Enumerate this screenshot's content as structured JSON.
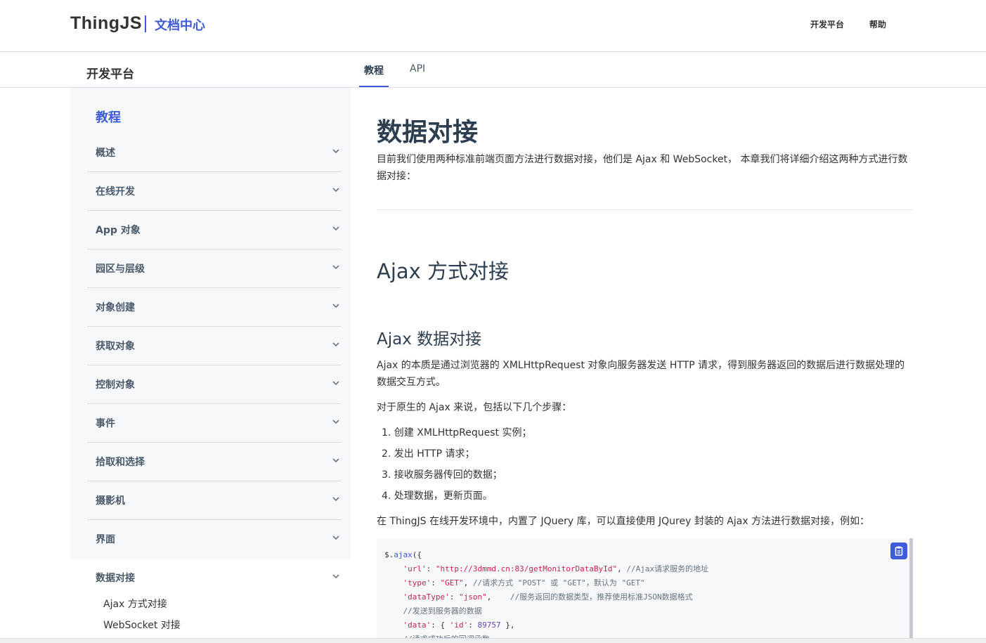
{
  "header": {
    "logo_text": "ThingJS",
    "logo_sub": "文档中心",
    "nav": [
      {
        "label": "开发平台"
      },
      {
        "label": "帮助"
      }
    ]
  },
  "subbar": {
    "title": "开发平台",
    "tabs": [
      {
        "label": "教程",
        "active": true
      },
      {
        "label": "API",
        "active": false
      }
    ]
  },
  "sidebar": {
    "heading": "教程",
    "items": [
      {
        "label": "概述"
      },
      {
        "label": "在线开发"
      },
      {
        "label": "App 对象"
      },
      {
        "label": "园区与层级"
      },
      {
        "label": "对象创建"
      },
      {
        "label": "获取对象"
      },
      {
        "label": "控制对象"
      },
      {
        "label": "事件"
      },
      {
        "label": "拾取和选择"
      },
      {
        "label": "摄影机"
      },
      {
        "label": "界面"
      },
      {
        "label": "数据对接"
      }
    ],
    "sub_items": [
      {
        "label": "Ajax 方式对接"
      },
      {
        "label": "WebSocket 对接"
      }
    ]
  },
  "article": {
    "title": "数据对接",
    "intro": "目前我们使用两种标准前端页面方法进行数据对接，他们是 Ajax 和 WebSocket， 本章我们将详细介绍这两种方式进行数据对接：",
    "h2": "Ajax 方式对接",
    "h3": "Ajax 数据对接",
    "p1": "Ajax 的本质是通过浏览器的 XMLHttpRequest 对象向服务器发送 HTTP 请求，得到服务器返回的数据后进行数据处理的数据交互方式。",
    "p2": "对于原生的 Ajax 来说，包括以下几个步骤：",
    "steps": [
      "1. 创建 XMLHttpRequest 实例；",
      "2. 发出 HTTP 请求；",
      "3. 接收服务器传回的数据；",
      "4. 处理数据，更新页面。"
    ],
    "p3": "在 ThingJS 在线开发环境中，内置了 JQuery 库，可以直接使用 JQurey 封装的 Ajax 方法进行数据对接，例如：",
    "code": {
      "line1_obj": "$.",
      "line1_fn": "ajax",
      "line1_rest": "({",
      "url_key": "'url'",
      "url_val": "\"http://3dmmd.cn:83/getMonitorDataById\"",
      "url_comment": "//Ajax请求服务的地址",
      "type_key": "'type'",
      "type_val": "\"GET\"",
      "type_comment": "//请求方式 \"POST\" 或 \"GET\"，默认为 \"GET\"",
      "dt_key": "'dataType'",
      "dt_val": "\"json\"",
      "dt_comment": "//服务返回的数据类型，推荐使用标准JSON数据格式",
      "send_comment": "//发送到服务器的数据",
      "data_key": "'data'",
      "data_open": "{ ",
      "id_key": "'id'",
      "id_val": "89757",
      "data_close": " },",
      "cb_comment": "//请求成功后的回调函数"
    }
  }
}
